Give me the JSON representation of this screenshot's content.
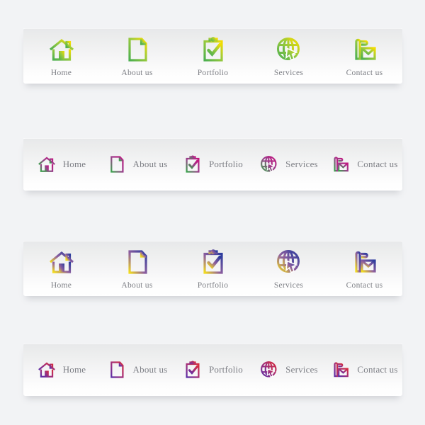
{
  "page": {
    "background_color": "#f2f3f5",
    "bar_background_top": "#e7e8ea",
    "bar_background_bottom": "#ffffff",
    "label_color": "#7d7f85"
  },
  "menu_labels": {
    "home": "Home",
    "about": "About us",
    "portfolio": "Portfolio",
    "services": "Services",
    "contact": "Contact us"
  },
  "icon_names": {
    "home": "home-icon",
    "about": "document-page-icon",
    "portfolio": "clipboard-check-icon",
    "services": "globe-cursor-icon",
    "contact": "phone-envelope-icon"
  },
  "navbars": [
    {
      "id": "navbar-1",
      "layout": "vertical",
      "gradient_from": "#4caf50",
      "gradient_to": "#f5dd00",
      "items": [
        {
          "label": "Home",
          "icon": "home-icon"
        },
        {
          "label": "About us",
          "icon": "document-page-icon"
        },
        {
          "label": "Portfolio",
          "icon": "clipboard-check-icon"
        },
        {
          "label": "Services",
          "icon": "globe-cursor-icon"
        },
        {
          "label": "Contact us",
          "icon": "phone-envelope-icon"
        }
      ]
    },
    {
      "id": "navbar-2",
      "layout": "horizontal",
      "gradient_from": "#3aa44c",
      "gradient_to": "#c3157f",
      "items": [
        {
          "label": "Home",
          "icon": "home-icon"
        },
        {
          "label": "About us",
          "icon": "document-page-icon"
        },
        {
          "label": "Portfolio",
          "icon": "clipboard-check-icon"
        },
        {
          "label": "Services",
          "icon": "globe-cursor-icon"
        },
        {
          "label": "Contact us",
          "icon": "phone-envelope-icon"
        }
      ]
    },
    {
      "id": "navbar-3",
      "layout": "vertical",
      "gradient_from": "#f2dc1e",
      "gradient_to": "#2b3c9e",
      "items": [
        {
          "label": "Home",
          "icon": "home-icon"
        },
        {
          "label": "About us",
          "icon": "document-page-icon"
        },
        {
          "label": "Portfolio",
          "icon": "clipboard-check-icon"
        },
        {
          "label": "Services",
          "icon": "globe-cursor-icon"
        },
        {
          "label": "Contact us",
          "icon": "phone-envelope-icon"
        }
      ]
    },
    {
      "id": "navbar-4",
      "layout": "horizontal",
      "gradient_from": "#5b2fa8",
      "gradient_to": "#d62b3c",
      "items": [
        {
          "label": "Home",
          "icon": "home-icon"
        },
        {
          "label": "About us",
          "icon": "document-page-icon"
        },
        {
          "label": "Portfolio",
          "icon": "clipboard-check-icon"
        },
        {
          "label": "Services",
          "icon": "globe-cursor-icon"
        },
        {
          "label": "Contact us",
          "icon": "phone-envelope-icon"
        }
      ]
    }
  ]
}
